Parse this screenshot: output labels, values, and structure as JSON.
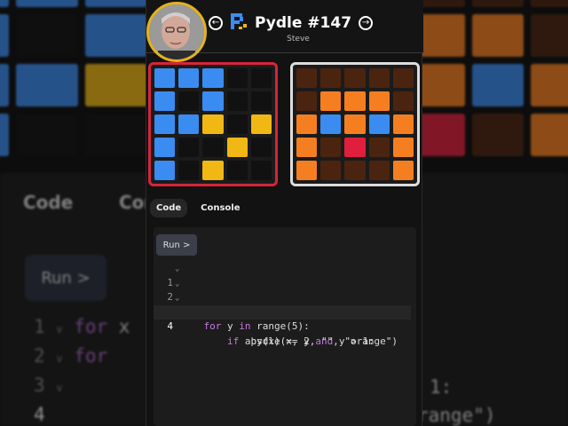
{
  "header": {
    "title": "Pydle #147",
    "subtitle": "Steve",
    "prev_icon": "arrow-left-circle-icon",
    "next_icon": "arrow-right-circle-icon",
    "logo_icon": "pydle-logo-icon"
  },
  "colors": {
    "blue": "#3b8cf0",
    "yellow": "#f0b715",
    "black": "#111111",
    "orange": "#f57f20",
    "brown": "#4b2410",
    "red": "#e01f3d",
    "user_border": "#d8243a",
    "avatar_ring": "#e5b21c"
  },
  "boards": {
    "user": [
      [
        "blue",
        "blue",
        "blue",
        "black",
        "black"
      ],
      [
        "blue",
        "black",
        "blue",
        "black",
        "black"
      ],
      [
        "blue",
        "blue",
        "yellow",
        "black",
        "yellow"
      ],
      [
        "blue",
        "black",
        "black",
        "yellow",
        "black"
      ],
      [
        "blue",
        "black",
        "yellow",
        "black",
        "black"
      ]
    ],
    "target": [
      [
        "brown",
        "brown",
        "brown",
        "brown",
        "brown"
      ],
      [
        "brown",
        "orange",
        "orange",
        "orange",
        "brown"
      ],
      [
        "orange",
        "blue",
        "orange",
        "blue",
        "orange"
      ],
      [
        "orange",
        "brown",
        "red",
        "brown",
        "orange"
      ],
      [
        "orange",
        "brown",
        "brown",
        "brown",
        "orange"
      ]
    ]
  },
  "tabs": [
    {
      "label": "Code",
      "active": true
    },
    {
      "label": "Console",
      "active": false
    }
  ],
  "editor": {
    "run_label": "Run >",
    "lines": [
      {
        "num": "1",
        "fold": true
      },
      {
        "num": "2",
        "fold": true
      },
      {
        "num": "3",
        "fold": true
      },
      {
        "num": "4",
        "fold": false
      }
    ]
  }
}
